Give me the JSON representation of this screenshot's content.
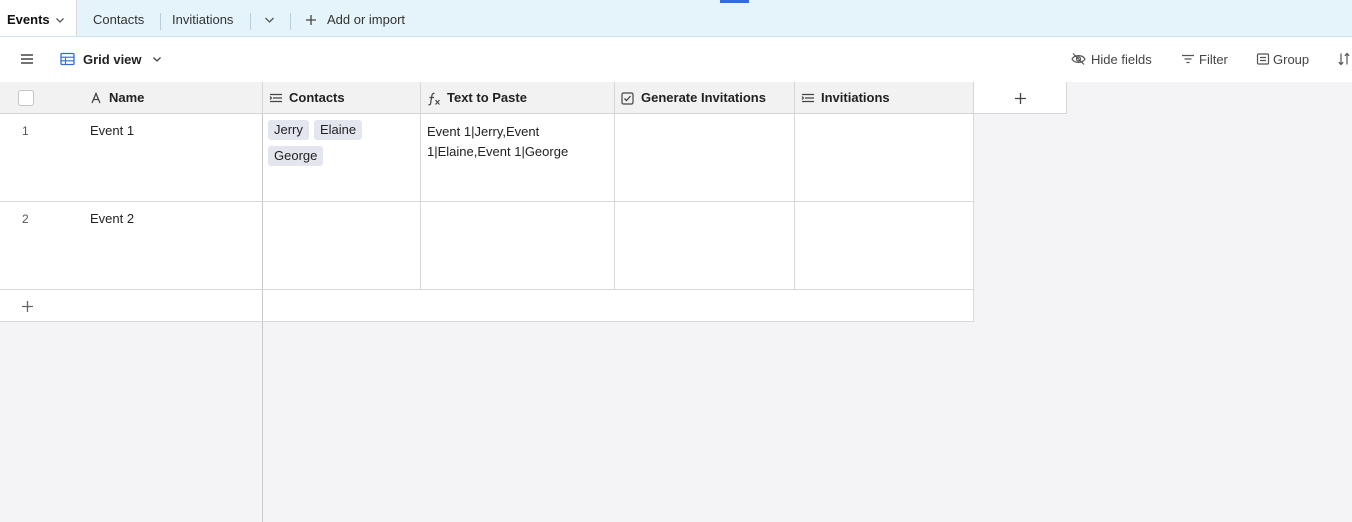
{
  "tabs": [
    {
      "label": "Events",
      "active": true
    },
    {
      "label": "Contacts"
    },
    {
      "label": "Invitiations"
    }
  ],
  "add_or_import": "Add or import",
  "toolbar": {
    "view_name": "Grid view",
    "hide_fields": "Hide fields",
    "filter": "Filter",
    "group": "Group"
  },
  "columns": {
    "name": "Name",
    "contacts": "Contacts",
    "text_to_paste": "Text to Paste",
    "generate_invitations": "Generate Invitations",
    "invitiations": "Invitiations"
  },
  "rows": [
    {
      "num": "1",
      "name": "Event 1",
      "contacts": [
        "Jerry",
        "Elaine",
        "George"
      ],
      "text_to_paste": "Event 1|Jerry,Event 1|Elaine,Event 1|George"
    },
    {
      "num": "2",
      "name": "Event 2",
      "contacts": [],
      "text_to_paste": ""
    }
  ],
  "colors": {
    "tabbar_bg": "#e4f4fa",
    "accent": "#2d6fd6",
    "chip_bg": "#e3e6ee",
    "header_bg": "#f2f2f2"
  }
}
